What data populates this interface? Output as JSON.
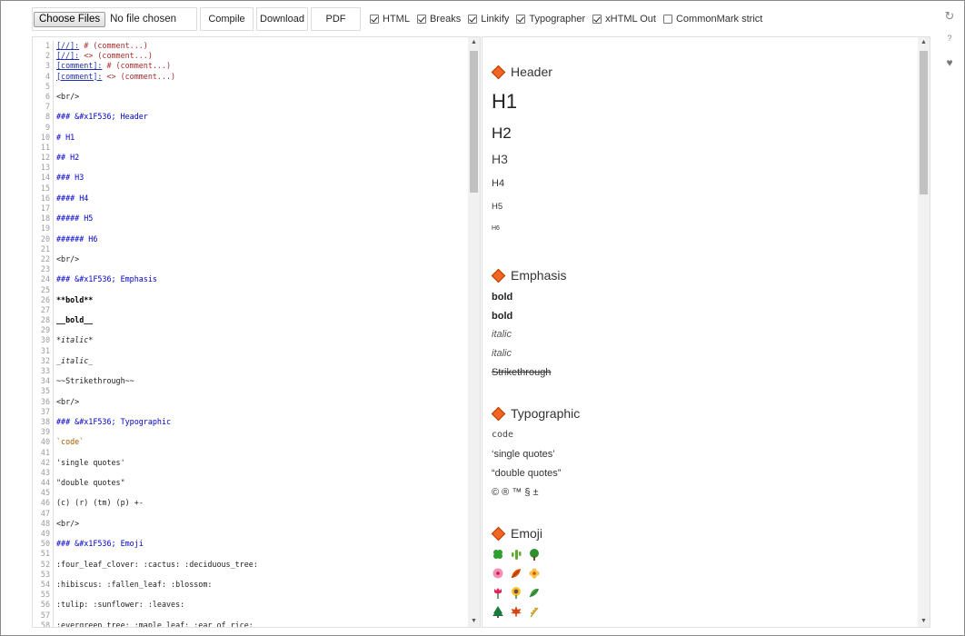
{
  "toolbar": {
    "file_button": "Choose Files",
    "file_status": "No file chosen",
    "compile": "Compile",
    "download": "Download",
    "pdf": "PDF",
    "options": [
      {
        "label": "HTML",
        "checked": true
      },
      {
        "label": "Breaks",
        "checked": true
      },
      {
        "label": "Linkify",
        "checked": true
      },
      {
        "label": "Typographer",
        "checked": true
      },
      {
        "label": "xHTML Out",
        "checked": true
      },
      {
        "label": "CommonMark strict",
        "checked": false
      }
    ]
  },
  "side_icons": [
    "refresh-icon",
    "help-icon",
    "heart-icon"
  ],
  "side_glyphs": {
    "refresh": "↻",
    "help": "?",
    "heart": "♥"
  },
  "editor": {
    "lines": [
      {
        "n": "1",
        "t": "[//]: # (comment...)",
        "k": "cmt"
      },
      {
        "n": "2",
        "t": "[//]: <> (comment...)",
        "k": "cmt"
      },
      {
        "n": "3",
        "t": "[comment]: # (comment...)",
        "k": "cmt"
      },
      {
        "n": "4",
        "t": "[comment]: <> (comment...)",
        "k": "cmt"
      },
      {
        "n": "5",
        "t": "",
        "k": "plain"
      },
      {
        "n": "6",
        "t": "<br/>",
        "k": "plain"
      },
      {
        "n": "7",
        "t": "",
        "k": "plain"
      },
      {
        "n": "8",
        "t": "### &#x1F536; Header",
        "k": "head"
      },
      {
        "n": "9",
        "t": "",
        "k": "plain"
      },
      {
        "n": "10",
        "t": "# H1",
        "k": "head"
      },
      {
        "n": "11",
        "t": "",
        "k": "plain"
      },
      {
        "n": "12",
        "t": "## H2",
        "k": "head"
      },
      {
        "n": "13",
        "t": "",
        "k": "plain"
      },
      {
        "n": "14",
        "t": "### H3",
        "k": "head"
      },
      {
        "n": "15",
        "t": "",
        "k": "plain"
      },
      {
        "n": "16",
        "t": "#### H4",
        "k": "head"
      },
      {
        "n": "17",
        "t": "",
        "k": "plain"
      },
      {
        "n": "18",
        "t": "##### H5",
        "k": "head"
      },
      {
        "n": "19",
        "t": "",
        "k": "plain"
      },
      {
        "n": "20",
        "t": "###### H6",
        "k": "head"
      },
      {
        "n": "21",
        "t": "",
        "k": "plain"
      },
      {
        "n": "22",
        "t": "<br/>",
        "k": "plain"
      },
      {
        "n": "23",
        "t": "",
        "k": "plain"
      },
      {
        "n": "24",
        "t": "### &#x1F536; Emphasis",
        "k": "head"
      },
      {
        "n": "25",
        "t": "",
        "k": "plain"
      },
      {
        "n": "26",
        "t": "**bold**",
        "k": "bold"
      },
      {
        "n": "27",
        "t": "",
        "k": "plain"
      },
      {
        "n": "28",
        "t": "__bold__",
        "k": "bold"
      },
      {
        "n": "29",
        "t": "",
        "k": "plain"
      },
      {
        "n": "30",
        "t": "*italic*",
        "k": "em"
      },
      {
        "n": "31",
        "t": "",
        "k": "plain"
      },
      {
        "n": "32",
        "t": "_italic_",
        "k": "em"
      },
      {
        "n": "33",
        "t": "",
        "k": "plain"
      },
      {
        "n": "34",
        "t": "~~Strikethrough~~",
        "k": "plain"
      },
      {
        "n": "35",
        "t": "",
        "k": "plain"
      },
      {
        "n": "36",
        "t": "<br/>",
        "k": "plain"
      },
      {
        "n": "37",
        "t": "",
        "k": "plain"
      },
      {
        "n": "38",
        "t": "### &#x1F536; Typographic",
        "k": "head"
      },
      {
        "n": "39",
        "t": "",
        "k": "plain"
      },
      {
        "n": "40",
        "t": "`code`",
        "k": "code"
      },
      {
        "n": "41",
        "t": "",
        "k": "plain"
      },
      {
        "n": "42",
        "t": "'single quotes'",
        "k": "plain"
      },
      {
        "n": "43",
        "t": "",
        "k": "plain"
      },
      {
        "n": "44",
        "t": "\"double quotes\"",
        "k": "plain"
      },
      {
        "n": "45",
        "t": "",
        "k": "plain"
      },
      {
        "n": "46",
        "t": "(c) (r) (tm) (p) +-",
        "k": "plain"
      },
      {
        "n": "47",
        "t": "",
        "k": "plain"
      },
      {
        "n": "48",
        "t": "<br/>",
        "k": "plain"
      },
      {
        "n": "49",
        "t": "",
        "k": "plain"
      },
      {
        "n": "50",
        "t": "### &#x1F536; Emoji",
        "k": "head"
      },
      {
        "n": "51",
        "t": "",
        "k": "plain"
      },
      {
        "n": "52",
        "t": ":four_leaf_clover: :cactus: :deciduous_tree:",
        "k": "plain"
      },
      {
        "n": "53",
        "t": "",
        "k": "plain"
      },
      {
        "n": "54",
        "t": ":hibiscus: :fallen_leaf: :blossom:",
        "k": "plain"
      },
      {
        "n": "55",
        "t": "",
        "k": "plain"
      },
      {
        "n": "56",
        "t": ":tulip: :sunflower: :leaves:",
        "k": "plain"
      },
      {
        "n": "57",
        "t": "",
        "k": "plain"
      },
      {
        "n": "58",
        "t": ":evergreen_tree: :maple_leaf: :ear_of_rice:",
        "k": "plain"
      }
    ]
  },
  "preview": {
    "header_section": "Header",
    "h1": "H1",
    "h2": "H2",
    "h3": "H3",
    "h4": "H4",
    "h5": "H5",
    "h6": "H6",
    "emphasis_section": "Emphasis",
    "bold1": "bold",
    "bold2": "bold",
    "italic1": "italic",
    "italic2": "italic",
    "strike": "Strikethrough",
    "typographic_section": "Typographic",
    "code": "code",
    "single_quotes": "‘single quotes’",
    "double_quotes": "“double quotes”",
    "symbols": "© ® ™ § ±",
    "emoji_section": "Emoji",
    "emoji_rows": [
      [
        "four-leaf-clover-icon",
        "cactus-icon",
        "deciduous-tree-icon"
      ],
      [
        "hibiscus-icon",
        "fallen-leaf-icon",
        "blossom-icon"
      ],
      [
        "tulip-icon",
        "sunflower-icon",
        "leaves-icon"
      ],
      [
        "evergreen-tree-icon",
        "maple-leaf-icon",
        "ear-of-rice-icon"
      ]
    ]
  },
  "colors": {
    "accent_diamond": "#f26522",
    "code_heading": "#0000c8",
    "code_comment": "#a52a2a",
    "code_link": "#1f2fb0"
  }
}
